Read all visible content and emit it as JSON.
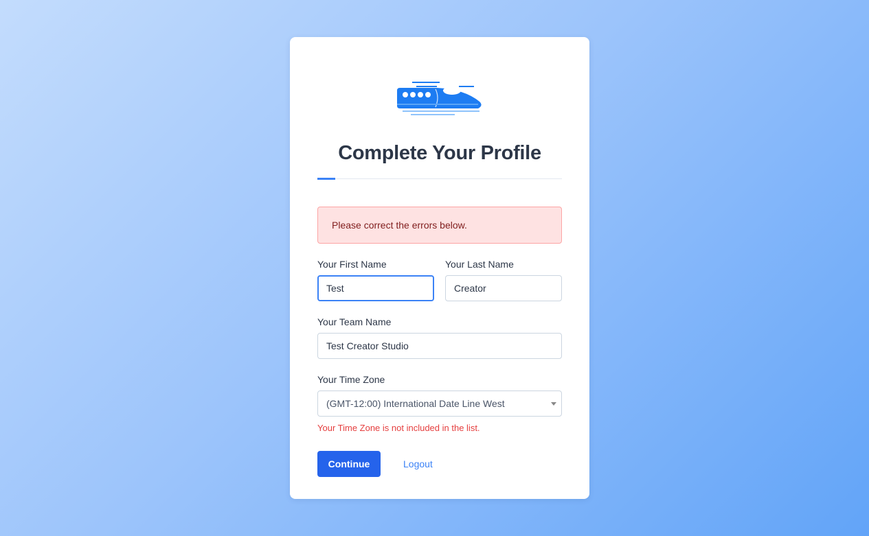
{
  "page": {
    "title": "Complete Your Profile"
  },
  "alert": {
    "message": "Please correct the errors below."
  },
  "form": {
    "first_name": {
      "label": "Your First Name",
      "value": "Test"
    },
    "last_name": {
      "label": "Your Last Name",
      "value": "Creator"
    },
    "team_name": {
      "label": "Your Team Name",
      "value": "Test Creator Studio"
    },
    "time_zone": {
      "label": "Your Time Zone",
      "selected": "(GMT-12:00) International Date Line West",
      "error": "Your Time Zone is not included in the list."
    }
  },
  "actions": {
    "continue_label": "Continue",
    "logout_label": "Logout"
  },
  "icons": {
    "logo": "bullet-train-logo-icon",
    "select_caret": "chevron-down-icon"
  },
  "colors": {
    "primary": "#2563eb",
    "accent": "#3b82f6",
    "error": "#e53e3e",
    "alert_bg": "#fee2e2",
    "title": "#2d3748"
  }
}
